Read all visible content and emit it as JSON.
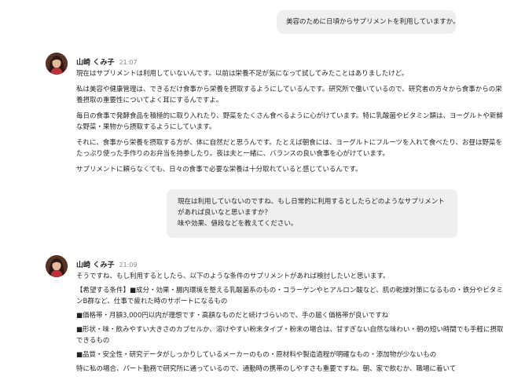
{
  "messages": {
    "user1": {
      "text": "美容のために日頃からサプリメントを利用していますか。"
    },
    "reply1": {
      "sender": "山崎 くみ子",
      "time": "21:07",
      "paragraphs": [
        "現在はサプリメントは利用していないんです。以前は栄養不足が気になって試してみたことはありましたけど。",
        "私は美容や健康管理は、できるだけ食事から栄養を摂取するようにしているんです。研究所で働いているので、研究者の方々から食事からの栄養摂取の重要性についてよく耳にするんですよ。",
        "毎日の食事で発酵食品を積極的に取り入れたり、野菜をたくさん食べるように心がけています。特に乳酸菌やビタミン類は、ヨーグルトや新鮮な野菜・果物から摂取するようにしています。",
        "それに、食事から栄養を摂取する方が、体に自然だと思うんです。たとえば朝食には、ヨーグルトにフルーツを入れて食べたり、お昼は野菜をたっぷり使った手作りのお弁当を持参したり。夜は夫と一緒に、バランスの良い食事を心がけています。",
        "サプリメントに頼らなくても、日々の食事で必要な栄養は十分取れていると感じているんです。"
      ]
    },
    "user2": {
      "lines": [
        "現在は利用していないのですね、もし日常的に利用するとしたらどのようなサプリメントがあれば良いなと思いますか？",
        "味や効果、値段などを教えてください。"
      ]
    },
    "reply2": {
      "sender": "山崎 くみ子",
      "time": "21:09",
      "paragraphs": [
        "そうですね、もし利用するとしたら、以下のような条件のサプリメントがあれば検討したいと思います。",
        "【希望する条件】■成分・効果・腸内環境を整える乳酸菌系のもの・コラーゲンやヒアルロン酸など、肌の乾燥対策になるもの・鉄分やビタミンB群など、仕事で疲れた時のサポートになるもの",
        "■価格帯・月額3,000円以内が理想です・高額なものだと続けづらいので、手の届く価格帯が良いですね",
        "■形状・味・飲みやすい大きさのカプセルか、溶けやすい粉末タイプ・粉末の場合は、甘すぎない自然な味わい・朝の短い時間でも手軽に摂取できるもの",
        "■品質・安全性・研究データがしっかりしているメーカーのもの・原材料や製造過程が明確なもの・添加物が少ないもの",
        "特に私の場合、パート勤務で研究所に通っているので、通勤時の携帯のしやすさも重要ですね。朝、家で飲むか、職場に着いて"
      ]
    }
  },
  "colors": {
    "bubble": "#efefef",
    "text": "#242424",
    "time": "#8a8a8a",
    "background": "#ffffff"
  }
}
